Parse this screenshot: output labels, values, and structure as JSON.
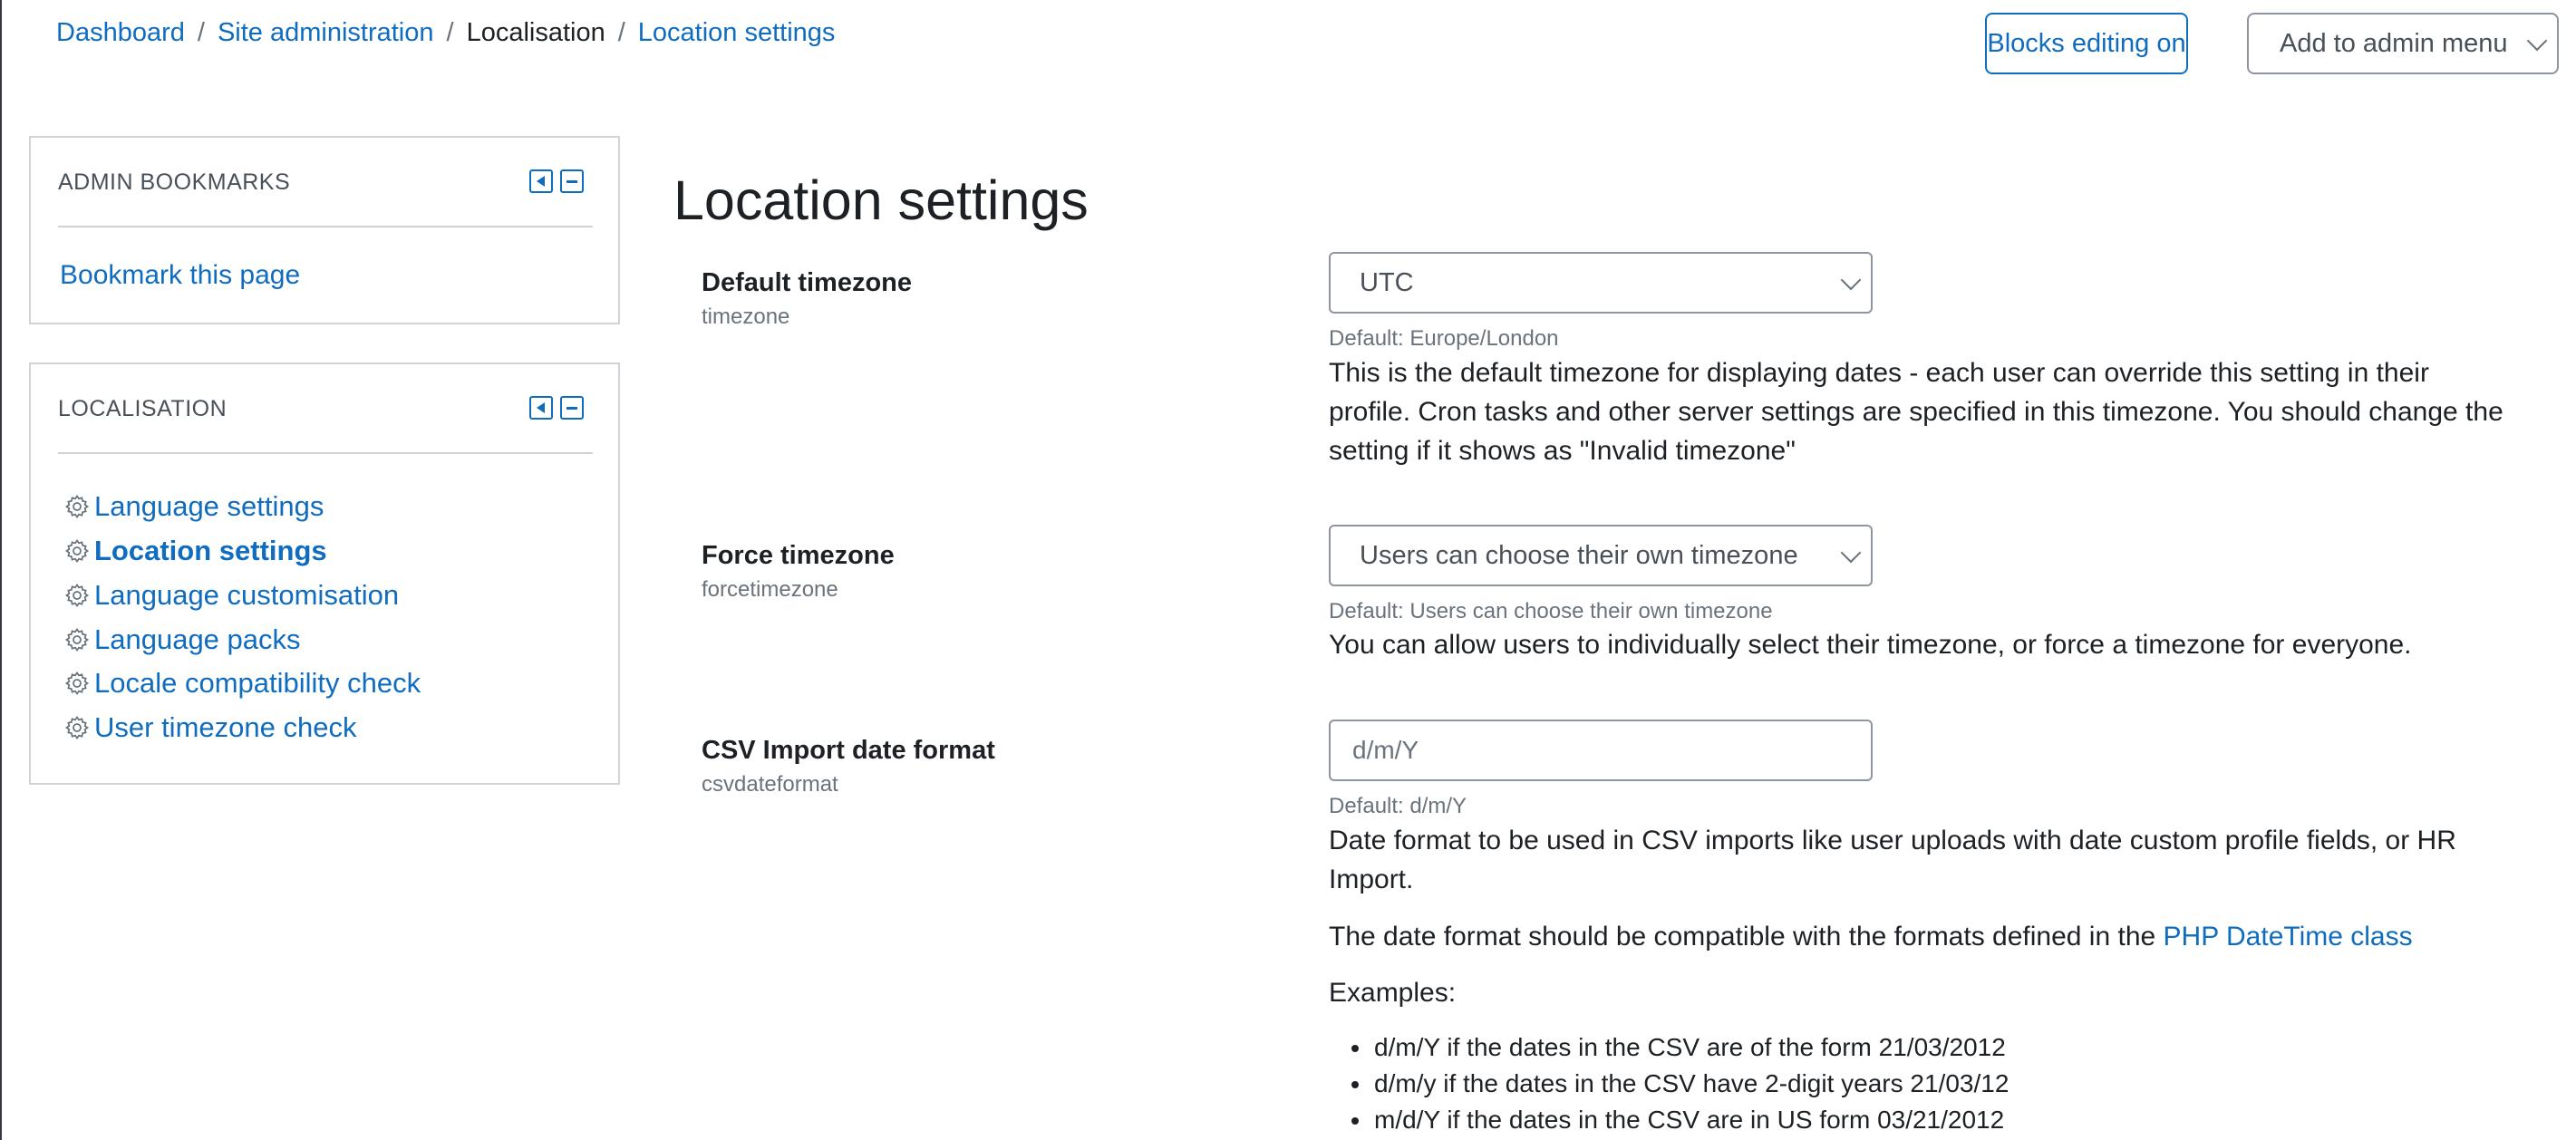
{
  "breadcrumb": {
    "items": [
      "Dashboard",
      "Site administration",
      "Localisation",
      "Location settings"
    ],
    "separator": "/"
  },
  "header": {
    "blocks_editing_label": "Blocks editing on",
    "admin_menu_select": "Add to admin menu"
  },
  "admin_bookmarks": {
    "title": "ADMIN BOOKMARKS",
    "link": "Bookmark this page"
  },
  "localisation": {
    "title": "LOCALISATION",
    "items": [
      {
        "label": "Language settings",
        "icon": "gear-icon"
      },
      {
        "label": "Location settings",
        "icon": "gear-icon",
        "active": true
      },
      {
        "label": "Language customisation",
        "icon": "gear-icon"
      },
      {
        "label": "Language packs",
        "icon": "gear-icon"
      },
      {
        "label": "Locale compatibility check",
        "icon": "gear-icon"
      },
      {
        "label": "User timezone check",
        "icon": "gear-icon"
      }
    ]
  },
  "main": {
    "title": "Location settings",
    "settings": [
      {
        "label": "Default timezone",
        "key": "timezone",
        "value": "UTC",
        "default": "Default: Europe/London",
        "description": "This is the default timezone for displaying dates - each user can override this setting in their profile. Cron tasks and other server settings are specified in this timezone. You should change the setting if it shows as \"Invalid timezone\""
      },
      {
        "label": "Force timezone",
        "key": "forcetimezone",
        "value": "Users can choose their own timezone",
        "default": "Default: Users can choose their own timezone",
        "description": "You can allow users to individually select their timezone, or force a timezone for everyone."
      },
      {
        "label": "CSV Import date format",
        "key": "csvdateformat",
        "value": "d/m/Y",
        "default": "Default: d/m/Y",
        "description": "Date format to be used in CSV imports like user uploads with date custom profile fields, or HR Import.",
        "compat_text": "The date format should be compatible with the formats defined in the",
        "compat_link": "PHP DateTime class",
        "examples_label": "Examples:",
        "examples": [
          "d/m/Y if the dates in the CSV are of the form 21/03/2012",
          "d/m/y if the dates in the CSV have 2-digit years 21/03/12",
          "m/d/Y if the dates in the CSV are in US form 03/21/2012"
        ]
      }
    ]
  },
  "colors": {
    "link": "#0f6cbf",
    "text": "#1d2125",
    "muted": "#6a737b",
    "border": "#8f959e"
  }
}
